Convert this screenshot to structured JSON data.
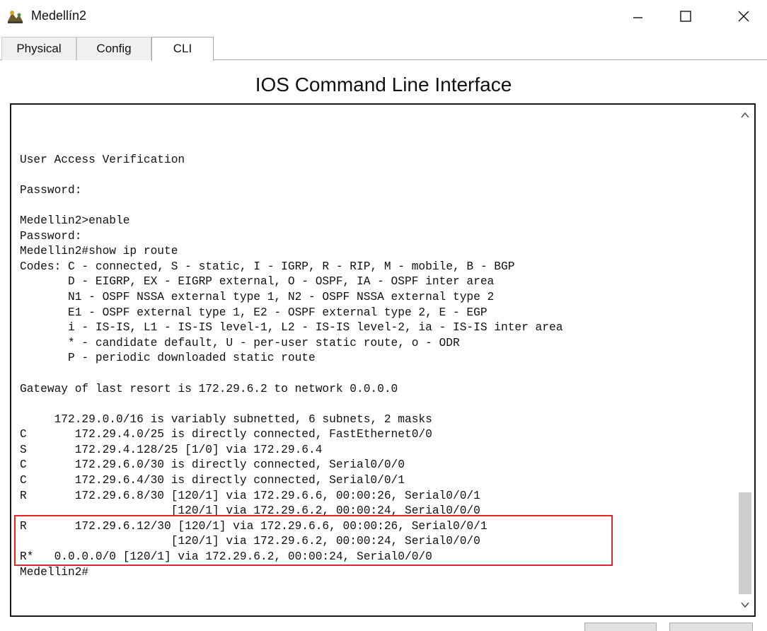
{
  "window": {
    "title": "Medellín2",
    "icon": "router-icon"
  },
  "partial_heading": "...",
  "tabs": [
    {
      "label": "Physical"
    },
    {
      "label": "Config"
    },
    {
      "label": "CLI"
    }
  ],
  "cli": {
    "heading": "IOS Command Line Interface",
    "lines": [
      "",
      "User Access Verification",
      "",
      "Password:",
      "",
      "Medellin2>enable",
      "Password:",
      "Medellin2#show ip route",
      "Codes: C - connected, S - static, I - IGRP, R - RIP, M - mobile, B - BGP",
      "       D - EIGRP, EX - EIGRP external, O - OSPF, IA - OSPF inter area",
      "       N1 - OSPF NSSA external type 1, N2 - OSPF NSSA external type 2",
      "       E1 - OSPF external type 1, E2 - OSPF external type 2, E - EGP",
      "       i - IS-IS, L1 - IS-IS level-1, L2 - IS-IS level-2, ia - IS-IS inter area",
      "       * - candidate default, U - per-user static route, o - ODR",
      "       P - periodic downloaded static route",
      "",
      "Gateway of last resort is 172.29.6.2 to network 0.0.0.0",
      "",
      "     172.29.0.0/16 is variably subnetted, 6 subnets, 2 masks",
      "C       172.29.4.0/25 is directly connected, FastEthernet0/0",
      "S       172.29.4.128/25 [1/0] via 172.29.6.4",
      "C       172.29.6.0/30 is directly connected, Serial0/0/0",
      "C       172.29.6.4/30 is directly connected, Serial0/0/1",
      "R       172.29.6.8/30 [120/1] via 172.29.6.6, 00:00:26, Serial0/0/1",
      "                      [120/1] via 172.29.6.2, 00:00:24, Serial0/0/0",
      "R       172.29.6.12/30 [120/1] via 172.29.6.6, 00:00:26, Serial0/0/1",
      "                      [120/1] via 172.29.6.2, 00:00:24, Serial0/0/0",
      "R*   0.0.0.0/0 [120/1] via 172.29.6.2, 00:00:24, Serial0/0/0",
      "Medellin2#"
    ]
  },
  "colors": {
    "highlight": "#e0262b",
    "console_border": "#1a1a1a"
  }
}
